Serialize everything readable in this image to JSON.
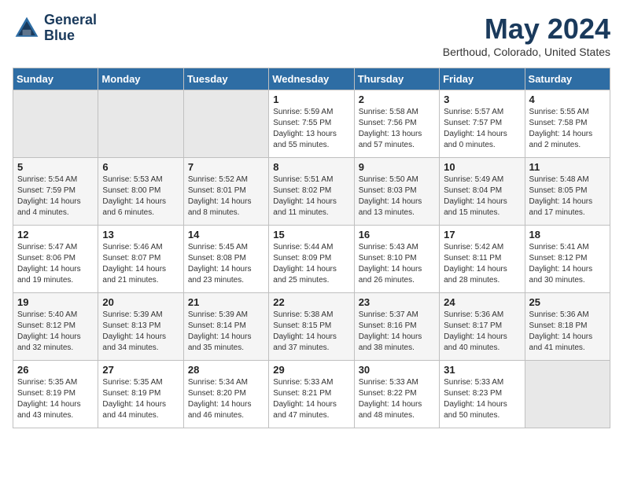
{
  "header": {
    "logo_line1": "General",
    "logo_line2": "Blue",
    "month": "May 2024",
    "location": "Berthoud, Colorado, United States"
  },
  "weekdays": [
    "Sunday",
    "Monday",
    "Tuesday",
    "Wednesday",
    "Thursday",
    "Friday",
    "Saturday"
  ],
  "weeks": [
    [
      {
        "day": "",
        "empty": true
      },
      {
        "day": "",
        "empty": true
      },
      {
        "day": "",
        "empty": true
      },
      {
        "day": "1",
        "sunrise": "5:59 AM",
        "sunset": "7:55 PM",
        "daylight": "13 hours and 55 minutes."
      },
      {
        "day": "2",
        "sunrise": "5:58 AM",
        "sunset": "7:56 PM",
        "daylight": "13 hours and 57 minutes."
      },
      {
        "day": "3",
        "sunrise": "5:57 AM",
        "sunset": "7:57 PM",
        "daylight": "14 hours and 0 minutes."
      },
      {
        "day": "4",
        "sunrise": "5:55 AM",
        "sunset": "7:58 PM",
        "daylight": "14 hours and 2 minutes."
      }
    ],
    [
      {
        "day": "5",
        "sunrise": "5:54 AM",
        "sunset": "7:59 PM",
        "daylight": "14 hours and 4 minutes."
      },
      {
        "day": "6",
        "sunrise": "5:53 AM",
        "sunset": "8:00 PM",
        "daylight": "14 hours and 6 minutes."
      },
      {
        "day": "7",
        "sunrise": "5:52 AM",
        "sunset": "8:01 PM",
        "daylight": "14 hours and 8 minutes."
      },
      {
        "day": "8",
        "sunrise": "5:51 AM",
        "sunset": "8:02 PM",
        "daylight": "14 hours and 11 minutes."
      },
      {
        "day": "9",
        "sunrise": "5:50 AM",
        "sunset": "8:03 PM",
        "daylight": "14 hours and 13 minutes."
      },
      {
        "day": "10",
        "sunrise": "5:49 AM",
        "sunset": "8:04 PM",
        "daylight": "14 hours and 15 minutes."
      },
      {
        "day": "11",
        "sunrise": "5:48 AM",
        "sunset": "8:05 PM",
        "daylight": "14 hours and 17 minutes."
      }
    ],
    [
      {
        "day": "12",
        "sunrise": "5:47 AM",
        "sunset": "8:06 PM",
        "daylight": "14 hours and 19 minutes."
      },
      {
        "day": "13",
        "sunrise": "5:46 AM",
        "sunset": "8:07 PM",
        "daylight": "14 hours and 21 minutes."
      },
      {
        "day": "14",
        "sunrise": "5:45 AM",
        "sunset": "8:08 PM",
        "daylight": "14 hours and 23 minutes."
      },
      {
        "day": "15",
        "sunrise": "5:44 AM",
        "sunset": "8:09 PM",
        "daylight": "14 hours and 25 minutes."
      },
      {
        "day": "16",
        "sunrise": "5:43 AM",
        "sunset": "8:10 PM",
        "daylight": "14 hours and 26 minutes."
      },
      {
        "day": "17",
        "sunrise": "5:42 AM",
        "sunset": "8:11 PM",
        "daylight": "14 hours and 28 minutes."
      },
      {
        "day": "18",
        "sunrise": "5:41 AM",
        "sunset": "8:12 PM",
        "daylight": "14 hours and 30 minutes."
      }
    ],
    [
      {
        "day": "19",
        "sunrise": "5:40 AM",
        "sunset": "8:12 PM",
        "daylight": "14 hours and 32 minutes."
      },
      {
        "day": "20",
        "sunrise": "5:39 AM",
        "sunset": "8:13 PM",
        "daylight": "14 hours and 34 minutes."
      },
      {
        "day": "21",
        "sunrise": "5:39 AM",
        "sunset": "8:14 PM",
        "daylight": "14 hours and 35 minutes."
      },
      {
        "day": "22",
        "sunrise": "5:38 AM",
        "sunset": "8:15 PM",
        "daylight": "14 hours and 37 minutes."
      },
      {
        "day": "23",
        "sunrise": "5:37 AM",
        "sunset": "8:16 PM",
        "daylight": "14 hours and 38 minutes."
      },
      {
        "day": "24",
        "sunrise": "5:36 AM",
        "sunset": "8:17 PM",
        "daylight": "14 hours and 40 minutes."
      },
      {
        "day": "25",
        "sunrise": "5:36 AM",
        "sunset": "8:18 PM",
        "daylight": "14 hours and 41 minutes."
      }
    ],
    [
      {
        "day": "26",
        "sunrise": "5:35 AM",
        "sunset": "8:19 PM",
        "daylight": "14 hours and 43 minutes."
      },
      {
        "day": "27",
        "sunrise": "5:35 AM",
        "sunset": "8:19 PM",
        "daylight": "14 hours and 44 minutes."
      },
      {
        "day": "28",
        "sunrise": "5:34 AM",
        "sunset": "8:20 PM",
        "daylight": "14 hours and 46 minutes."
      },
      {
        "day": "29",
        "sunrise": "5:33 AM",
        "sunset": "8:21 PM",
        "daylight": "14 hours and 47 minutes."
      },
      {
        "day": "30",
        "sunrise": "5:33 AM",
        "sunset": "8:22 PM",
        "daylight": "14 hours and 48 minutes."
      },
      {
        "day": "31",
        "sunrise": "5:33 AM",
        "sunset": "8:23 PM",
        "daylight": "14 hours and 50 minutes."
      },
      {
        "day": "",
        "empty": true
      }
    ]
  ]
}
